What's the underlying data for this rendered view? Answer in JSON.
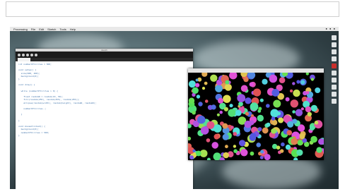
{
  "menubar": {
    "items": [
      "Processing",
      "File",
      "Edit",
      "Sketch",
      "Tools",
      "Help"
    ],
    "status": "● ● ●"
  },
  "editor": {
    "title": "sketch",
    "code": "int numberOfCircles = 500;\n\nvoid setup() {\n  size(600, 400);\n  background(0);\n}\n\nvoid draw() {\n\n  while (numberOfCircles > 0) {\n\n    float randomD = random(10, 50);\n    fill(random(255), random(255), random(255));\n    ellipse(random(width), random(height), randomD, randomD);\n\n    numberOfCircles--;\n\n  }\n\n}\n\nvoid mouseClicked() {\n  background(0);\n  numberOfCircles = 500;\n}"
  },
  "colors": {
    "code_text": "#3a6fa8",
    "editor_toolbar": "#1a1a1a",
    "canvas_bg": "#000000"
  },
  "dock": {
    "icons": [
      "finder-icon",
      "app-icon",
      "app-icon",
      "app-icon",
      "recording-icon",
      "app-icon",
      "app-icon",
      "app-icon",
      "app-icon",
      "app-icon"
    ]
  }
}
